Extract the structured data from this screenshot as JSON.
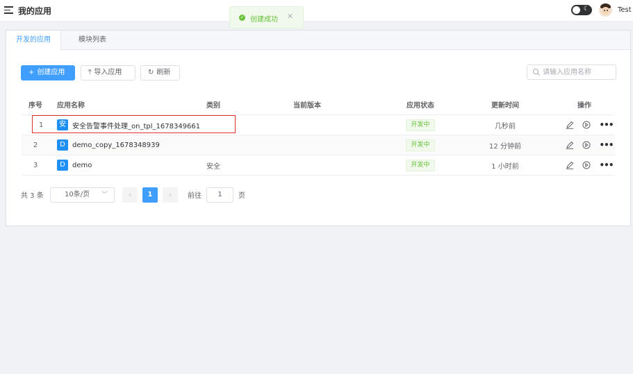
{
  "header": {
    "title": "我的应用",
    "user_name": "Test",
    "theme_icon": "moon-icon"
  },
  "toast": {
    "message": "创建成功",
    "close": "✕"
  },
  "tabs": [
    {
      "label": "开发的应用",
      "active": true
    },
    {
      "label": "模块列表",
      "active": false
    }
  ],
  "toolbar": {
    "create_label": "创建应用",
    "create_icon": "+",
    "import_label": "导入应用",
    "import_icon": "⤒",
    "refresh_label": "刷新",
    "refresh_icon": "↻",
    "search_placeholder": "请输入应用名称",
    "search_value": ""
  },
  "table": {
    "columns": [
      "序号",
      "应用名称",
      "类别",
      "当前版本",
      "应用状态",
      "更新时间",
      "操作"
    ],
    "rows": [
      {
        "index": "1",
        "icon_text": "安",
        "name": "安全告警事件处理_on_tpl_1678349661",
        "category": "",
        "version": "",
        "status": "开发中",
        "updated": "几秒前"
      },
      {
        "index": "2",
        "icon_text": "D",
        "name": "demo_copy_1678348939",
        "category": "",
        "version": "",
        "status": "开发中",
        "updated": "12 分钟前"
      },
      {
        "index": "3",
        "icon_text": "D",
        "name": "demo",
        "category": "安全",
        "version": "",
        "status": "开发中",
        "updated": "1 小时前"
      }
    ],
    "more_label": "•••"
  },
  "pagination": {
    "total": "共 3 条",
    "page_size": "10条/页",
    "prev": "‹",
    "current": "1",
    "next": "›",
    "goto_label": "前往",
    "goto_value": "1",
    "page_suffix": "页"
  },
  "colors": {
    "primary": "#409eff",
    "success": "#67c23a",
    "highlight": "#e02e2e"
  }
}
